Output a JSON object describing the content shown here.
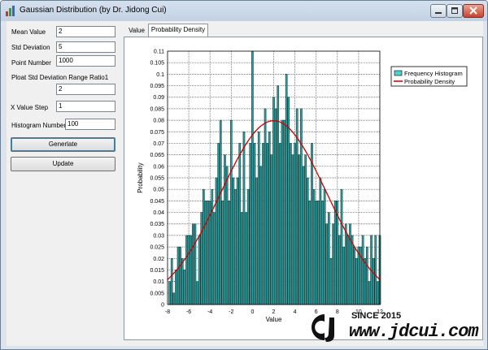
{
  "window": {
    "title": "Gaussian Distribution (by Dr. Jidong Cui)"
  },
  "form": {
    "mean_label": "Mean Value",
    "mean_value": "2",
    "std_label": "Std Deviation",
    "std_value": "5",
    "points_label": "Point Number",
    "points_value": "1000",
    "ratio_label": "Ploat Std Deviation Range Ratio1",
    "ratio_value": "2",
    "xstep_label": "X Value Step",
    "xstep_value": "1",
    "hist_label": "Histogram Number",
    "hist_value": "100",
    "generate_label": "Generlate",
    "update_label": "Update"
  },
  "tabs": [
    {
      "label": "Value"
    },
    {
      "label": "Probability Density"
    }
  ],
  "watermark": {
    "since": "SINCE 2015",
    "url": "www.jdcui.com"
  },
  "colors": {
    "bar_fill": "#2f9c9c",
    "curve": "#cc0000",
    "grid": "#4d4d4d"
  },
  "chart_data": {
    "type": "bar",
    "xlabel": "Value",
    "ylabel": "Probability",
    "xlim": [
      -8,
      12
    ],
    "ylim": [
      0,
      0.11
    ],
    "xticks": [
      -8,
      -6,
      -4,
      -2,
      0,
      2,
      4,
      6,
      8,
      10,
      12
    ],
    "yticks": [
      0,
      0.005,
      0.01,
      0.015,
      0.02,
      0.025,
      0.03,
      0.035,
      0.04,
      0.045,
      0.05,
      0.055,
      0.06,
      0.065,
      0.07,
      0.075,
      0.08,
      0.085,
      0.09,
      0.095,
      0.1,
      0.105,
      0.11
    ],
    "grid": true,
    "legend_position": "top-right",
    "series": [
      {
        "name": "Frequency Histogram",
        "type": "bar",
        "x": [
          -7.8,
          -7.6,
          -7.4,
          -7.2,
          -7.0,
          -6.8,
          -6.6,
          -6.4,
          -6.2,
          -6.0,
          -5.8,
          -5.6,
          -5.4,
          -5.2,
          -5.0,
          -4.8,
          -4.6,
          -4.4,
          -4.2,
          -4.0,
          -3.8,
          -3.6,
          -3.4,
          -3.2,
          -3.0,
          -2.8,
          -2.6,
          -2.4,
          -2.2,
          -2.0,
          -1.8,
          -1.6,
          -1.4,
          -1.2,
          -1.0,
          -0.8,
          -0.6,
          -0.4,
          -0.2,
          0.0,
          0.2,
          0.4,
          0.6,
          0.8,
          1.0,
          1.2,
          1.4,
          1.6,
          1.8,
          2.0,
          2.2,
          2.4,
          2.6,
          2.8,
          3.0,
          3.2,
          3.4,
          3.6,
          3.8,
          4.0,
          4.2,
          4.4,
          4.6,
          4.8,
          5.0,
          5.2,
          5.4,
          5.6,
          5.8,
          6.0,
          6.2,
          6.4,
          6.6,
          6.8,
          7.0,
          7.2,
          7.4,
          7.6,
          7.8,
          8.0,
          8.2,
          8.4,
          8.6,
          8.8,
          9.0,
          9.2,
          9.4,
          9.6,
          9.8,
          10.0,
          10.2,
          10.4,
          10.6,
          10.8,
          11.0,
          11.2,
          11.4,
          11.6,
          11.8,
          12.0
        ],
        "values": [
          0.01,
          0.02,
          0.005,
          0.015,
          0.025,
          0.025,
          0.02,
          0.015,
          0.03,
          0.03,
          0.03,
          0.035,
          0.035,
          0.01,
          0.03,
          0.04,
          0.05,
          0.045,
          0.045,
          0.045,
          0.05,
          0.04,
          0.055,
          0.07,
          0.08,
          0.045,
          0.065,
          0.06,
          0.045,
          0.08,
          0.055,
          0.05,
          0.055,
          0.07,
          0.04,
          0.075,
          0.04,
          0.05,
          0.07,
          0.11,
          0.07,
          0.055,
          0.075,
          0.06,
          0.07,
          0.085,
          0.07,
          0.075,
          0.065,
          0.09,
          0.085,
          0.095,
          0.07,
          0.08,
          0.08,
          0.1,
          0.09,
          0.07,
          0.065,
          0.07,
          0.085,
          0.065,
          0.085,
          0.06,
          0.065,
          0.055,
          0.045,
          0.07,
          0.05,
          0.045,
          0.045,
          0.055,
          0.045,
          0.05,
          0.035,
          0.04,
          0.02,
          0.035,
          0.045,
          0.045,
          0.03,
          0.05,
          0.025,
          0.035,
          0.03,
          0.035,
          0.03,
          0.025,
          0.02,
          0.025,
          0.025,
          0.03,
          0.02,
          0.025,
          0.01,
          0.03,
          0.02,
          0.03,
          0.01,
          0.03
        ]
      },
      {
        "name": "Probability Density",
        "type": "line",
        "mean": 2,
        "std": 5,
        "x": [
          -8,
          -7,
          -6,
          -5,
          -4,
          -3,
          -2,
          -1,
          0,
          1,
          2,
          3,
          4,
          5,
          6,
          7,
          8,
          9,
          10,
          11,
          12
        ],
        "values": [
          0.011,
          0.016,
          0.022,
          0.03,
          0.039,
          0.048,
          0.058,
          0.067,
          0.074,
          0.078,
          0.08,
          0.078,
          0.074,
          0.067,
          0.058,
          0.048,
          0.039,
          0.03,
          0.022,
          0.016,
          0.011
        ]
      }
    ]
  }
}
